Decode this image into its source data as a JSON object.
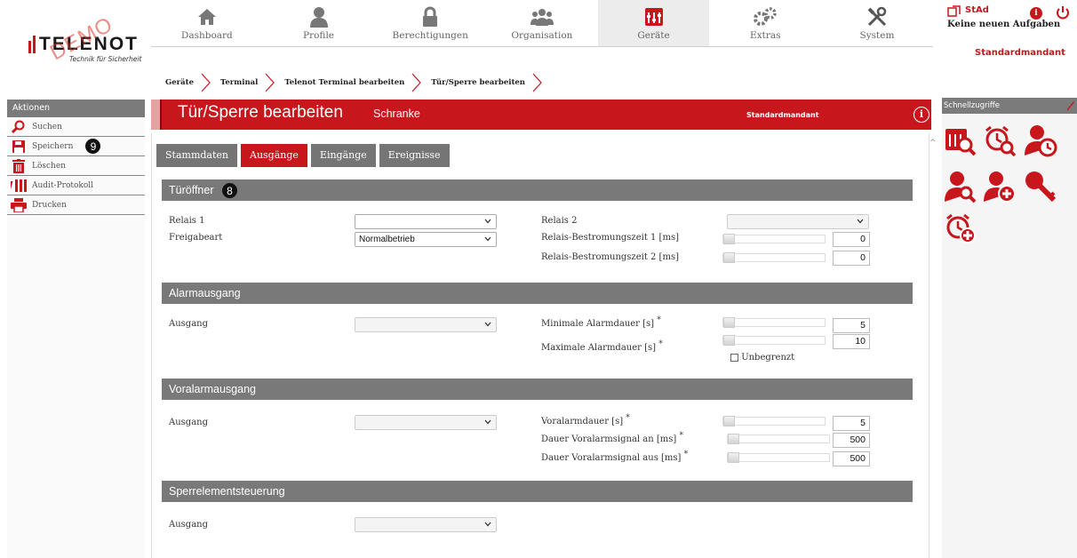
{
  "brand": {
    "name": "TELENOT",
    "tagline": "Technik für Sicherheit",
    "watermark": "DEMO"
  },
  "colors": {
    "accent": "#c8161d",
    "section_bg": "#797979",
    "tab_bg": "#757575"
  },
  "nav": [
    {
      "label": "Dashboard",
      "icon": "house-icon"
    },
    {
      "label": "Profile",
      "icon": "person-icon"
    },
    {
      "label": "Berechtigungen",
      "icon": "padlock-icon"
    },
    {
      "label": "Organisation",
      "icon": "group-icon"
    },
    {
      "label": "Geräte",
      "icon": "devices-icon",
      "active": true
    },
    {
      "label": "Extras",
      "icon": "gears-icon"
    },
    {
      "label": "System",
      "icon": "tools-icon"
    }
  ],
  "user": {
    "name": "StAd",
    "tasks": "Keine neuen Aufgaben",
    "mandant": "Standardmandant"
  },
  "breadcrumb": [
    "Geräte",
    "Terminal",
    "Telenot Terminal bearbeiten",
    "Tür/Sperre bearbeiten"
  ],
  "sidebar": {
    "title": "Aktionen",
    "items": [
      {
        "label": "Suchen",
        "icon": "magnifier-icon"
      },
      {
        "label": "Speichern",
        "icon": "floppy-icon",
        "badge": "9"
      },
      {
        "label": "Löschen",
        "icon": "trash-icon"
      },
      {
        "label": "Audit-Protokoll",
        "icon": "audit-icon"
      },
      {
        "label": "Drucken",
        "icon": "printer-icon"
      }
    ]
  },
  "page": {
    "title": "Tür/Sperre bearbeiten",
    "subtitle": "Schranke",
    "mandant": "Standardmandant",
    "info": "i"
  },
  "tabs": [
    {
      "label": "Stammdaten"
    },
    {
      "label": "Ausgänge",
      "active": true
    },
    {
      "label": "Eingänge"
    },
    {
      "label": "Ereignisse"
    }
  ],
  "sections": {
    "tueroeffner": {
      "title": "Türöffner",
      "badge": "8",
      "relais1_label": "Relais 1",
      "relais1_value": "",
      "freigabeart_label": "Freigabeart",
      "freigabeart_value": "Normalbetrieb",
      "relais2_label": "Relais 2",
      "relais2_value": "",
      "bestromung1_label": "Relais-Bestromungszeit 1 [ms]",
      "bestromung1_value": "0",
      "bestromung2_label": "Relais-Bestromungszeit 2 [ms]",
      "bestromung2_value": "0"
    },
    "alarmausgang": {
      "title": "Alarmausgang",
      "ausgang_label": "Ausgang",
      "ausgang_value": "",
      "min_label": "Minimale Alarmdauer [s]",
      "min_value": "5",
      "max_label": "Maximale Alarmdauer [s]",
      "max_value": "10",
      "unbegrenzt_label": "Unbegrenzt",
      "unbegrenzt_checked": false
    },
    "voralarmausgang": {
      "title": "Voralarmausgang",
      "ausgang_label": "Ausgang",
      "ausgang_value": "",
      "dauer_label": "Voralarmdauer [s]",
      "dauer_value": "5",
      "an_label": "Dauer Voralarmsignal an [ms]",
      "an_value": "500",
      "aus_label": "Dauer Voralarmsignal aus [ms]",
      "aus_value": "500"
    },
    "sperrelement": {
      "title": "Sperrelementsteuerung",
      "ausgang_label": "Ausgang",
      "ausgang_value": ""
    }
  },
  "required_marker": "*",
  "quick_access": {
    "title": "Schnellzugriffe",
    "items": [
      "device-search-icon",
      "alarm-search-icon",
      "person-clock-icon",
      "person-search-icon",
      "person-add-icon",
      "key-search-icon",
      "alarm-add-icon"
    ]
  }
}
